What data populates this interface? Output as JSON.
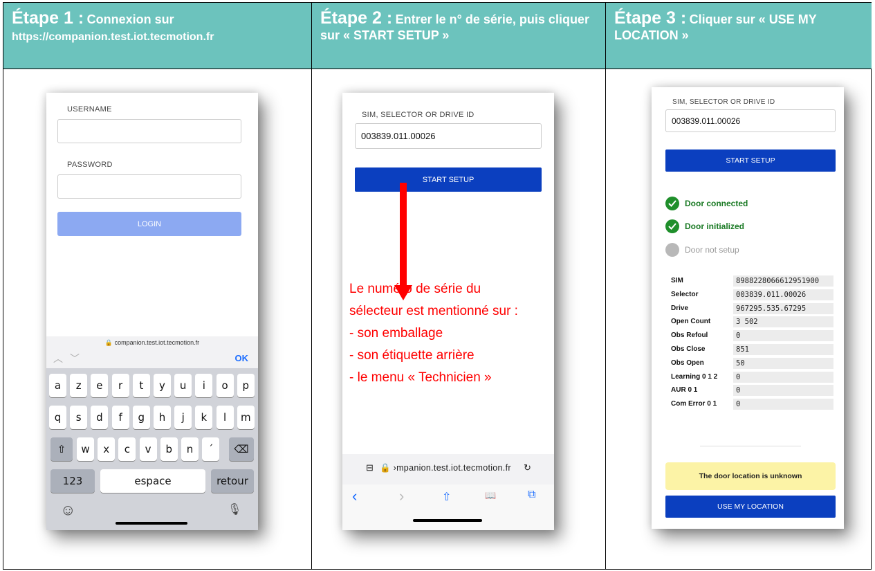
{
  "headers": [
    {
      "step": "Étape 1 :",
      "desc": "Connexion sur",
      "url": "https://companion.test.iot.tecmotion.fr"
    },
    {
      "step": "Étape 2 :",
      "desc": "Entrer le n° de série, puis cliquer sur « START SETUP »"
    },
    {
      "step": "Étape 3 :",
      "desc": "Cliquer sur « USE MY LOCATION »"
    }
  ],
  "screen1": {
    "username_label": "USERNAME",
    "password_label": "PASSWORD",
    "login_label": "LOGIN",
    "url_bar": "🔒 companion.test.iot.tecmotion.fr",
    "ok_label": "OK",
    "row1": [
      "a",
      "z",
      "e",
      "r",
      "t",
      "y",
      "u",
      "i",
      "o",
      "p"
    ],
    "row2": [
      "q",
      "s",
      "d",
      "f",
      "g",
      "h",
      "j",
      "k",
      "l",
      "m"
    ],
    "row3": [
      "w",
      "x",
      "c",
      "v",
      "b",
      "n",
      "´"
    ],
    "shift_icon": "⇧",
    "backspace_icon": "⌫",
    "num_key": "123",
    "space_key": "espace",
    "return_key": "retour",
    "emoji_icon": "☺",
    "mic_icon": "🎙",
    "nav_up_icon": "︿",
    "nav_down_icon": "﹀"
  },
  "screen2": {
    "field_label": "SIM, SELECTOR OR DRIVE ID",
    "field_value": "003839.011.00026",
    "start_label": "START SETUP",
    "note_lines": [
      "Le numéro de série du",
      "sélecteur est mentionné sur :",
      "- son emballage",
      "- son étiquette arrière",
      "- le menu « Technicien »"
    ],
    "url_bar": "🔒 ›mpanion.test.iot.tecmotion.fr",
    "reload_icon": "↻",
    "tabs_icon": "⊟",
    "back_icon": "‹",
    "forward_icon": "›",
    "share_icon": "⇧",
    "book_icon": "📖",
    "copy_icon": "⧉"
  },
  "screen3": {
    "field_label": "SIM, SELECTOR OR DRIVE ID",
    "field_value": "003839.011.00026",
    "start_label": "START SETUP",
    "statuses": [
      {
        "label": "Door connected",
        "state": "ok"
      },
      {
        "label": "Door initialized",
        "state": "ok"
      },
      {
        "label": "Door not setup",
        "state": "pending"
      }
    ],
    "details": [
      {
        "k": "SIM",
        "v": "8988228066612951900"
      },
      {
        "k": "Selector",
        "v": "003839.011.00026"
      },
      {
        "k": "Drive",
        "v": "967295.535.67295"
      },
      {
        "k": "Open Count",
        "v": "3 502"
      },
      {
        "k": "Obs Refoul",
        "v": "0"
      },
      {
        "k": "Obs Close",
        "v": "851"
      },
      {
        "k": "Obs Open",
        "v": "50"
      },
      {
        "k": "Learning 0 1 2",
        "v": "0"
      },
      {
        "k": "AUR 0 1",
        "v": "0"
      },
      {
        "k": "Com Error 0 1",
        "v": "0"
      }
    ],
    "location_msg": "The door location is unknown",
    "location_btn": "USE MY LOCATION"
  },
  "colors": {
    "header_bg": "#6cc3bd",
    "primary": "#0b3fbf",
    "success": "#1a8a2a",
    "warn_bg": "#fcf3a6",
    "arrow": "#ff0000"
  }
}
